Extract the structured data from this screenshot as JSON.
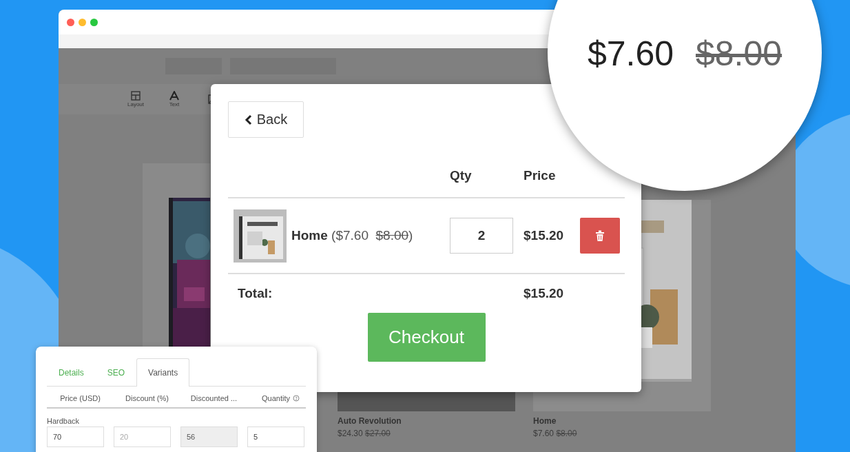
{
  "browser": {
    "toolbar": [
      {
        "label": "Layout",
        "kind": "layout"
      },
      {
        "label": "Text",
        "kind": "text"
      },
      {
        "kind": "picture"
      }
    ],
    "products": [
      {
        "name": "Auto Revolution",
        "price": "$24.30",
        "old_price": "$27.00",
        "kind": "plain"
      },
      {
        "name": "Home",
        "price": "$7.60",
        "old_price": "$8.00",
        "kind": "picture"
      }
    ]
  },
  "cart": {
    "back": "Back",
    "columns": [
      "Qty",
      "Price"
    ],
    "items": [
      {
        "name": "Home",
        "price": "($7.60",
        "old_price": "$8.00",
        "close": ")",
        "qty": "2",
        "total": "$15.20"
      }
    ],
    "total_label": "Total:",
    "total": "$15.20",
    "checkout": "Checkout"
  },
  "zoom": {
    "price": "$7.60",
    "old_price": "$8.00"
  },
  "variants": {
    "tabs": [
      {
        "label": "Details",
        "selected": false
      },
      {
        "label": "SEO",
        "selected": false
      },
      {
        "label": "Variants",
        "selected": true
      }
    ],
    "columns": [
      "Price (USD)",
      "Discount (%)",
      "Discounted ...",
      "Quantity"
    ],
    "group": "Hardback",
    "fields": [
      {
        "value": "70",
        "disabled": false
      },
      {
        "placeholder": "20",
        "disabled": false
      },
      {
        "value": "56",
        "disabled": true
      },
      {
        "value": "5",
        "disabled": false
      }
    ]
  }
}
